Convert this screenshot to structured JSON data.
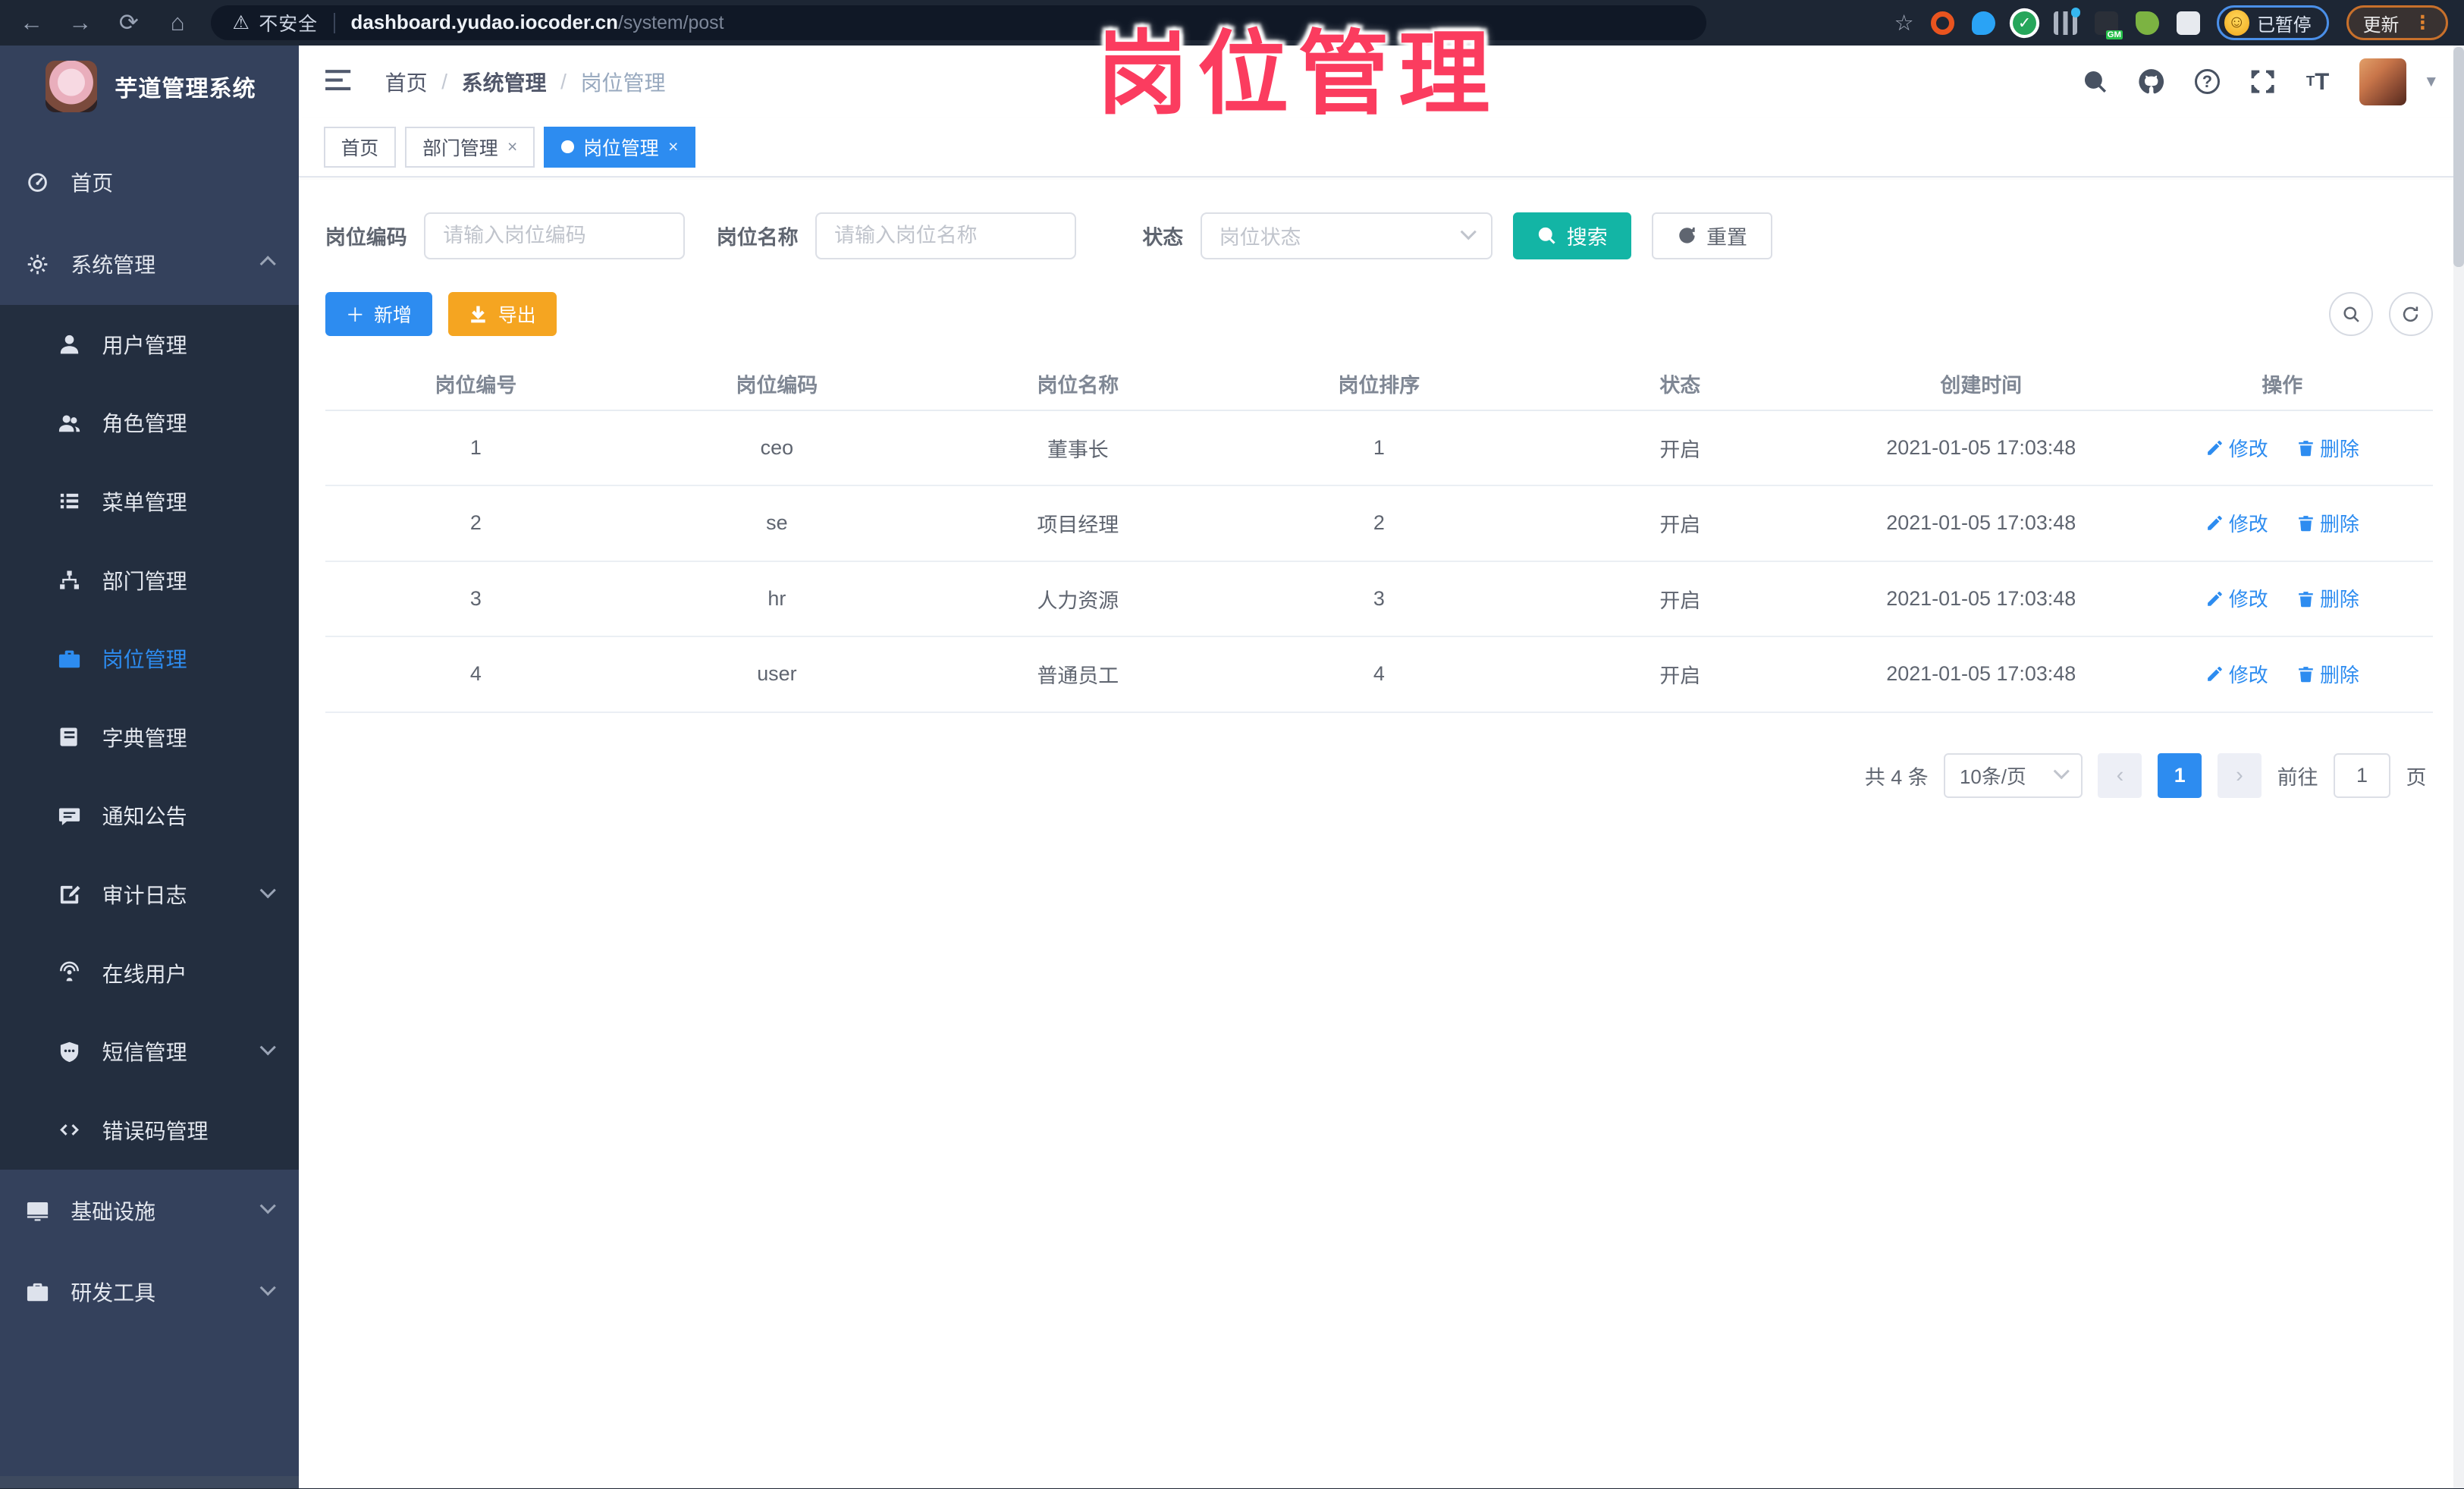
{
  "watermark": "岗位管理",
  "browser": {
    "security_label": "不安全",
    "url_host": "dashboard.yudao.iocoder.cn",
    "url_path": "/system/post",
    "paused_badge": "已暂停",
    "update_label": "更新"
  },
  "sidebar": {
    "app_title": "芋道管理系统",
    "items": [
      {
        "label": "首页",
        "icon": "dashboard-icon",
        "level": "top"
      },
      {
        "label": "系统管理",
        "icon": "gear-icon",
        "level": "top",
        "arrow": "up"
      },
      {
        "label": "用户管理",
        "icon": "user-icon",
        "level": "sub"
      },
      {
        "label": "角色管理",
        "icon": "users-icon",
        "level": "sub"
      },
      {
        "label": "菜单管理",
        "icon": "menu-list-icon",
        "level": "sub"
      },
      {
        "label": "部门管理",
        "icon": "org-tree-icon",
        "level": "sub"
      },
      {
        "label": "岗位管理",
        "icon": "post-icon",
        "level": "sub",
        "active": true
      },
      {
        "label": "字典管理",
        "icon": "dict-icon",
        "level": "sub"
      },
      {
        "label": "通知公告",
        "icon": "notice-icon",
        "level": "sub"
      },
      {
        "label": "审计日志",
        "icon": "audit-log-icon",
        "level": "sub",
        "arrow": "down"
      },
      {
        "label": "在线用户",
        "icon": "online-user-icon",
        "level": "sub"
      },
      {
        "label": "短信管理",
        "icon": "sms-icon",
        "level": "sub",
        "arrow": "down"
      },
      {
        "label": "错误码管理",
        "icon": "error-code-icon",
        "level": "sub"
      },
      {
        "label": "基础设施",
        "icon": "infra-icon",
        "level": "top",
        "arrow": "down"
      },
      {
        "label": "研发工具",
        "icon": "dev-tools-icon",
        "level": "top",
        "arrow": "down"
      }
    ]
  },
  "header": {
    "breadcrumb": [
      "首页",
      "系统管理",
      "岗位管理"
    ]
  },
  "tabs": [
    {
      "label": "首页",
      "active": false,
      "closable": false
    },
    {
      "label": "部门管理",
      "active": false,
      "closable": true
    },
    {
      "label": "岗位管理",
      "active": true,
      "closable": true
    }
  ],
  "filters": {
    "post_code_label": "岗位编码",
    "post_code_placeholder": "请输入岗位编码",
    "post_name_label": "岗位名称",
    "post_name_placeholder": "请输入岗位名称",
    "status_label": "状态",
    "status_placeholder": "岗位状态",
    "search_label": "搜索",
    "reset_label": "重置"
  },
  "toolbar": {
    "add_label": "新增",
    "export_label": "导出"
  },
  "table": {
    "columns": [
      "岗位编号",
      "岗位编码",
      "岗位名称",
      "岗位排序",
      "状态",
      "创建时间",
      "操作"
    ],
    "edit_label": "修改",
    "delete_label": "删除",
    "rows": [
      {
        "id": "1",
        "code": "ceo",
        "name": "董事长",
        "sort": "1",
        "status": "开启",
        "created": "2021-01-05 17:03:48"
      },
      {
        "id": "2",
        "code": "se",
        "name": "项目经理",
        "sort": "2",
        "status": "开启",
        "created": "2021-01-05 17:03:48"
      },
      {
        "id": "3",
        "code": "hr",
        "name": "人力资源",
        "sort": "3",
        "status": "开启",
        "created": "2021-01-05 17:03:48"
      },
      {
        "id": "4",
        "code": "user",
        "name": "普通员工",
        "sort": "4",
        "status": "开启",
        "created": "2021-01-05 17:03:48"
      }
    ]
  },
  "pagination": {
    "total_label": "共 4 条",
    "page_size_label": "10条/页",
    "prev_icon": "‹",
    "next_icon": "›",
    "current_page": "1",
    "goto_label": "前往",
    "goto_value": "1",
    "page_unit_label": "页"
  },
  "colors": {
    "accent_blue": "#2d8cf0",
    "search_teal": "#13b5a5",
    "export_orange": "#f5a521",
    "watermark_pink": "#fb3c5f",
    "sidebar_bg": "#34415c",
    "submenu_bg": "#232e3f",
    "chrome_bg": "#1d2634"
  }
}
